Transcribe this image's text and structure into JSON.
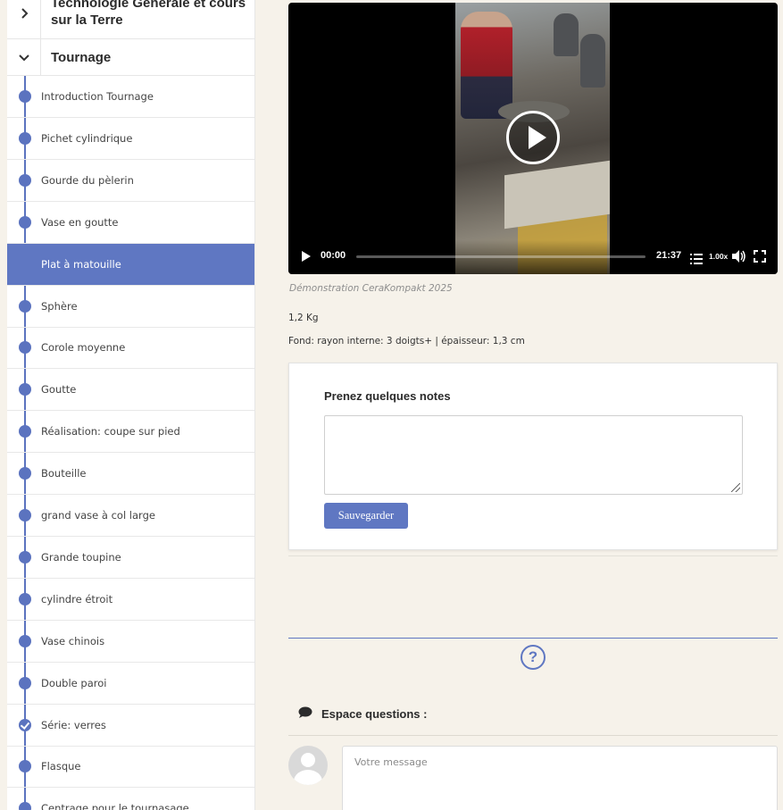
{
  "sidebar": {
    "prev_section_title": "Technologie Générale et cours sur la Terre",
    "current_section_title": "Tournage",
    "lessons": [
      {
        "label": "Introduction Tournage"
      },
      {
        "label": "Pichet cylindrique"
      },
      {
        "label": "Gourde du pèlerin"
      },
      {
        "label": "Vase en goutte"
      },
      {
        "label": "Plat à matouille",
        "active": true
      },
      {
        "label": "Sphère"
      },
      {
        "label": "Corole moyenne"
      },
      {
        "label": "Goutte"
      },
      {
        "label": "Réalisation: coupe sur pied"
      },
      {
        "label": "Bouteille"
      },
      {
        "label": "grand vase à col large"
      },
      {
        "label": "Grande toupine"
      },
      {
        "label": "cylindre étroit"
      },
      {
        "label": "Vase chinois"
      },
      {
        "label": "Double paroi"
      },
      {
        "label": "Série: verres",
        "completed": true
      },
      {
        "label": "Flasque"
      },
      {
        "label": "Centrage pour le tournasage"
      }
    ],
    "accent_color": "#5f77c2"
  },
  "video": {
    "current_time": "00:00",
    "duration": "21:37",
    "speed": "1.00x",
    "progress": 0,
    "caption": "Démonstration CeraKompakt 2025"
  },
  "details": {
    "weight": "1,2 Kg",
    "base": "Fond: rayon interne: 3 doigts+ | épaisseur: 1,3 cm"
  },
  "notes": {
    "title": "Prenez quelques notes",
    "value": "",
    "save_label": "Sauvegarder"
  },
  "questions": {
    "title": "Espace questions :",
    "placeholder": "Votre message"
  }
}
